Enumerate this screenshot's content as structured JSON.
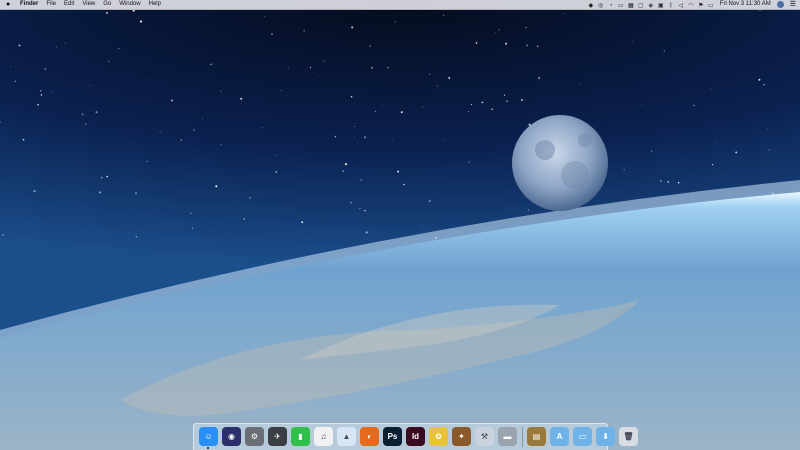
{
  "menubar": {
    "apple_icon": "apple-logo-icon",
    "items": [
      "Finder",
      "File",
      "Edit",
      "View",
      "Go",
      "Window",
      "Help"
    ],
    "clock": "Fri Nov 3  11:30 AM",
    "status_icons": [
      "dropbox-icon",
      "eye-icon",
      "wifi-signal-icon",
      "folder-icon",
      "calendar-icon",
      "display-icon",
      "shield-icon",
      "apps-icon",
      "bluetooth-icon",
      "volume-icon",
      "wifi-icon",
      "flag-icon",
      "battery-icon"
    ]
  },
  "dock": {
    "apps": [
      {
        "name": "finder-icon",
        "color": "#2a8ff5",
        "glyph": "☺",
        "running": true
      },
      {
        "name": "siri-icon",
        "color": "#2b2f6a",
        "glyph": "◉"
      },
      {
        "name": "system-preferences-icon",
        "color": "#6b6f75",
        "glyph": "⚙"
      },
      {
        "name": "launchpad-icon",
        "color": "#3b3f45",
        "glyph": "✈"
      },
      {
        "name": "facetime-icon",
        "color": "#2fbf4a",
        "glyph": "▮"
      },
      {
        "name": "itunes-icon",
        "color": "#f1f1f4",
        "glyph": "♫"
      },
      {
        "name": "photos-icon",
        "color": "#d7e6f5",
        "glyph": "▲"
      },
      {
        "name": "firefox-icon",
        "color": "#e56a1c",
        "glyph": "◐"
      },
      {
        "name": "photoshop-icon",
        "color": "#0b1f33",
        "glyph": "Ps"
      },
      {
        "name": "indesign-icon",
        "color": "#3a0a1f",
        "glyph": "Id"
      },
      {
        "name": "stuffit-icon",
        "color": "#e8c33a",
        "glyph": "✿"
      },
      {
        "name": "sequel-pro-icon",
        "color": "#8a5a2a",
        "glyph": "✦"
      },
      {
        "name": "xcode-icon",
        "color": "#c8d3de",
        "glyph": "⚒"
      },
      {
        "name": "server-icon",
        "color": "#9aa4ae",
        "glyph": "▬"
      }
    ],
    "folders": [
      {
        "name": "archive-utility-icon",
        "color": "#9a7a3a",
        "glyph": "▤"
      },
      {
        "name": "applications-folder-icon",
        "color": "#6fb2e8",
        "glyph": "A"
      },
      {
        "name": "documents-folder-icon",
        "color": "#6fb2e8",
        "glyph": "▭"
      },
      {
        "name": "downloads-folder-icon",
        "color": "#6fb2e8",
        "glyph": "⬇"
      },
      {
        "name": "trash-icon",
        "color": "#d7dde2",
        "glyph": "🗑"
      }
    ]
  }
}
